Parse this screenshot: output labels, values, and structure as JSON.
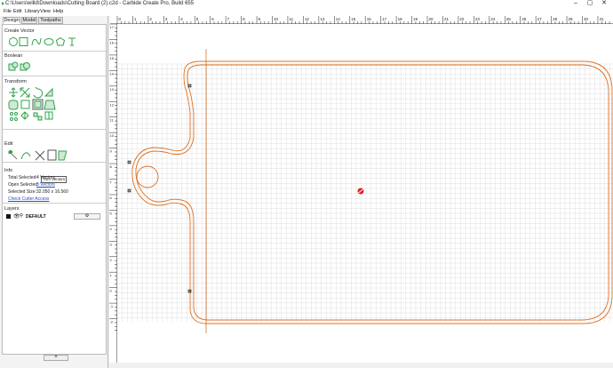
{
  "window": {
    "title": "C:\\Users\\willd\\Downloads\\Cutting Board (2).c2d - Carbide Create Pro, Build 655",
    "controls": [
      "–",
      "▢",
      "✕"
    ]
  },
  "menu": [
    "File",
    "Edit",
    "Library",
    "View",
    "Help"
  ],
  "tabs": [
    "Design",
    "Model",
    "Toolpaths"
  ],
  "sections": {
    "create_vector": "Create Vector",
    "boolean": "Boolean",
    "transform": "Transform",
    "edit": "Edit",
    "info": "Info",
    "layers": "Layers"
  },
  "tooltip": "Trim Vectors",
  "info": {
    "total_selected_label": "Total Selected:",
    "total_selected_value": "4 Vectors",
    "open_selected_label": "Open Selected:",
    "open_selected_value": "3 Vectors",
    "selected_size_label": "Selected Size:",
    "selected_size_value": "32.050 x 16.560",
    "check_cutter_access": "Check Cutter Access"
  },
  "layers": [
    {
      "name": "DEFAULT",
      "settings_icon": "gear-icon"
    }
  ],
  "add_layer_label": "+",
  "rulers": {
    "horizontal": [
      "0",
      "1",
      "2",
      "3",
      "4",
      "5",
      "6",
      "7",
      "8",
      "9",
      "10",
      "11",
      "12",
      "13",
      "14",
      "15",
      "16",
      "17",
      "18",
      "19",
      "20",
      "21",
      "22",
      "23",
      "24",
      "25",
      "26",
      "27",
      "28",
      "29",
      "30",
      "31",
      "32"
    ],
    "vertical": [
      "17",
      "16",
      "15",
      "14",
      "13",
      "12",
      "11",
      "10",
      "9",
      "8",
      "7",
      "6",
      "5",
      "4",
      "3",
      "2",
      "1",
      "0",
      "-1",
      "-2"
    ]
  },
  "colors": {
    "accent": "#e07020",
    "tool_green": "#2fa34a",
    "grid": "#dddddd"
  }
}
